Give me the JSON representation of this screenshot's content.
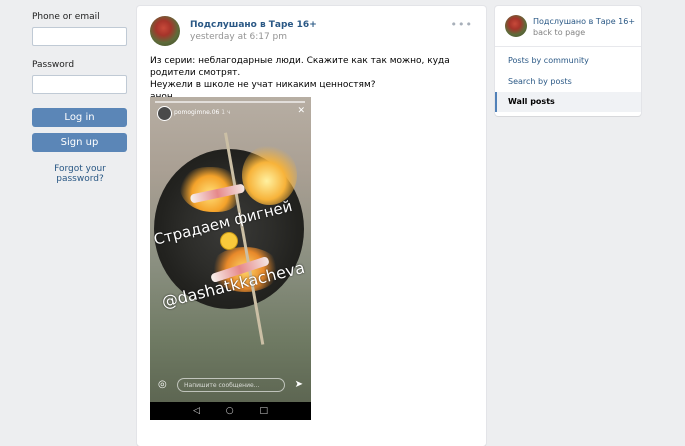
{
  "login": {
    "phone_label": "Phone or email",
    "password_label": "Password",
    "login_button": "Log in",
    "signup_button": "Sign up",
    "forgot_link": "Forgot your password?"
  },
  "post": {
    "author": "Подслушано в Тape 16+",
    "time": "yesterday at 6:17 pm",
    "more_icon": "ellipsis-icon",
    "text_line1": "Из серии: неблагодарные люди. Скажите как так можно, куда родители смотрят.",
    "text_line2": "Неужели в школе не учат никаким ценностям?",
    "text_line3": "анон.",
    "story": {
      "username": "pomogimne.06",
      "username_suffix": "1 ч",
      "caption1": "Страдаем фигней",
      "caption2": "@dashatkkacheva",
      "message_placeholder": "Напишите сообщение...",
      "nav_back": "◁",
      "nav_home": "○",
      "nav_recent": "□"
    }
  },
  "menu": {
    "name": "Подслушано в Тape 16+",
    "back": "back to page",
    "items": [
      {
        "label": "Posts by community",
        "active": false
      },
      {
        "label": "Search by posts",
        "active": false
      },
      {
        "label": "Wall posts",
        "active": true
      }
    ]
  },
  "colors": {
    "background": "#edeef0",
    "link": "#2a5885",
    "button": "#5b86b7"
  }
}
